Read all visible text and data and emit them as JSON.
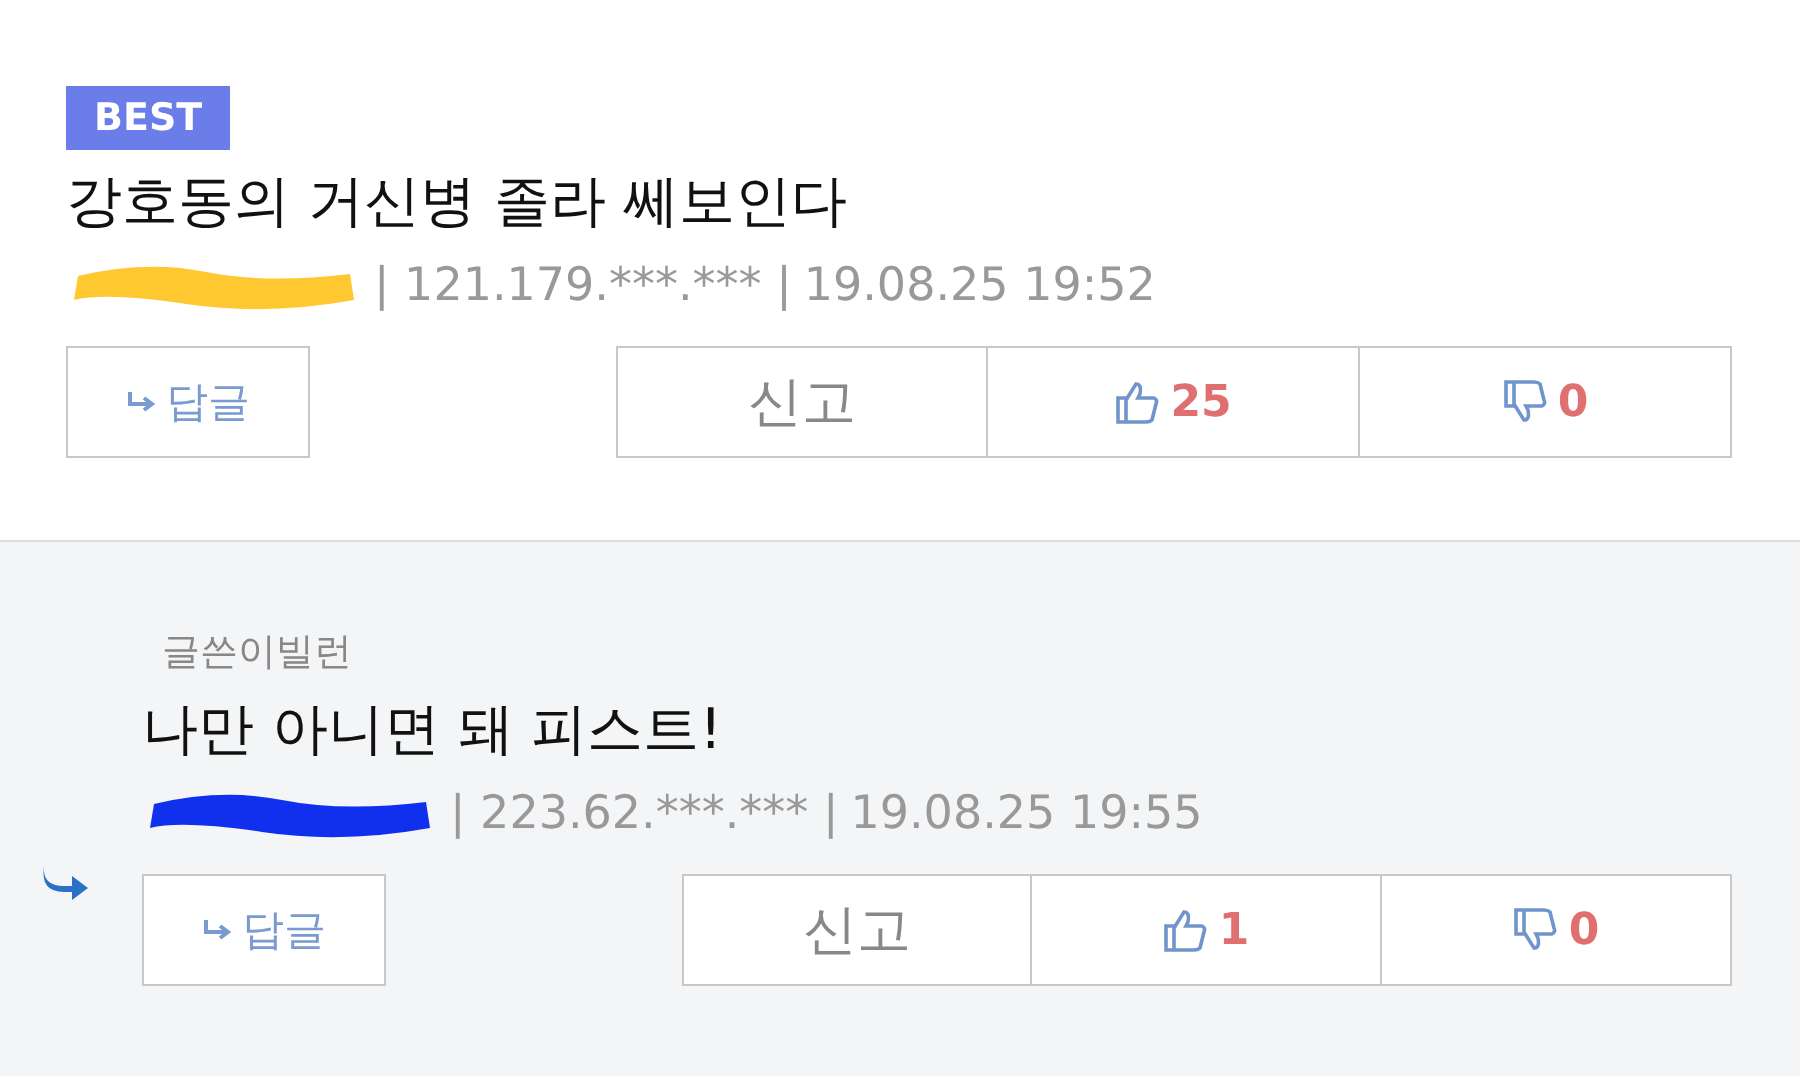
{
  "comments": [
    {
      "kind": "best",
      "badge": "BEST",
      "text": "강호동의 거신병 졸라 쎄보인다",
      "author_redaction": {
        "color": "#ffc830"
      },
      "ip": "| 121.179.***.*** |",
      "time": "19.08.25 19:52",
      "reply_button": "답글",
      "report_button": "신고",
      "likes": "25",
      "dislikes": "0"
    },
    {
      "kind": "reply",
      "author_label": "글쓴이빌런",
      "text": "나만 아니면 돼 피스트!",
      "author_redaction": {
        "color": "#1030ee"
      },
      "ip": "| 223.62.***.*** |",
      "time": "19.08.25 19:55",
      "reply_button": "답글",
      "report_button": "신고",
      "likes": "1",
      "dislikes": "0"
    }
  ]
}
